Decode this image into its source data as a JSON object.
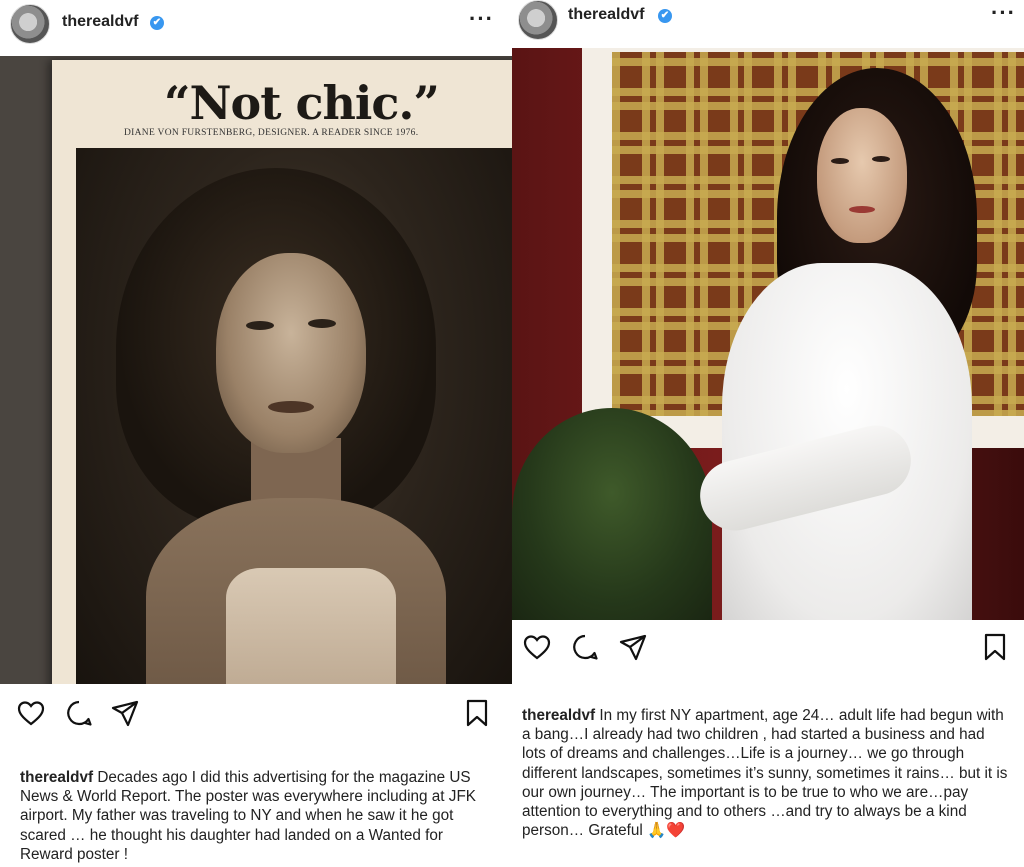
{
  "posts": [
    {
      "username": "therealdvf",
      "verified_mark": "✔",
      "more_label": "···",
      "ad": {
        "headline": "“Not chic.”",
        "subline": "DIANE VON FURSTENBERG, DESIGNER. A READER SINCE 1976."
      },
      "caption_text": "Decades ago I did this advertising for the magazine US News & World Report. The poster was everywhere including at JFK airport. My father was traveling to NY and when he saw it he got scared … he thought his daughter had landed on a  Wanted for Reward poster !",
      "icons": [
        "heart-icon",
        "comment-icon",
        "share-icon",
        "bookmark-icon"
      ]
    },
    {
      "username": "therealdvf",
      "verified_mark": "✔",
      "more_label": "···",
      "caption_text": "In my first NY apartment, age 24… adult life had begun with a bang…I already had two children , had started a business and had lots of dreams and challenges…Life is a journey… we go through different landscapes, sometimes it’s sunny, sometimes it rains… but it is our own journey… The important is to be true to who we are…pay attention to everything and to others …and try to always be a kind person… Grateful",
      "caption_emoji": "🙏",
      "caption_heart": "❤️",
      "icons": [
        "heart-icon",
        "comment-icon",
        "share-icon",
        "bookmark-icon"
      ]
    }
  ]
}
